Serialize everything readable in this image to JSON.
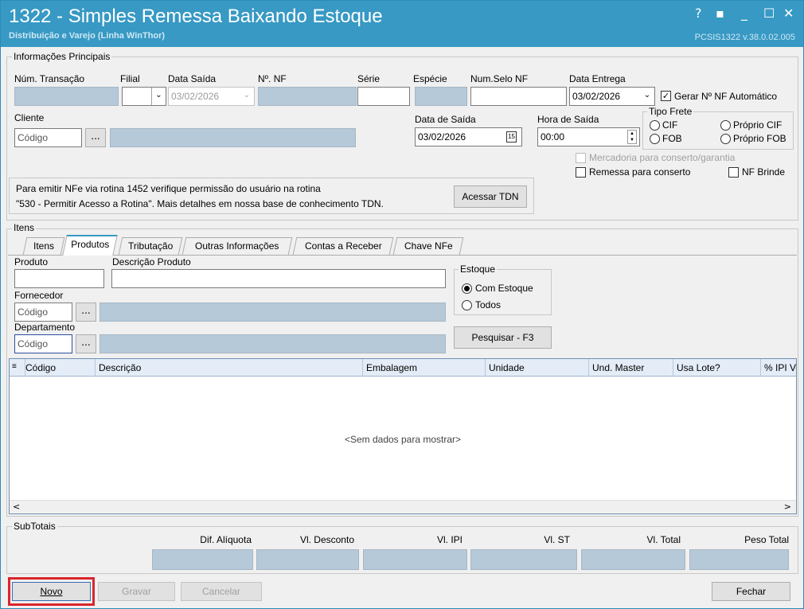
{
  "window": {
    "title": "1322 - Simples Remessa Baixando Estoque",
    "subtitle": "Distribuição e Varejo (Linha WinThor)",
    "version": "PCSIS1322  v.38.0.02.005",
    "controls": [
      "?",
      "▪",
      "_",
      "☐",
      "✕"
    ]
  },
  "principais": {
    "group_label": "Informações Principais",
    "labels": {
      "num_transacao": "Núm. Transação",
      "filial": "Filial",
      "data_saida": "Data Saída",
      "num_nf": "Nº. NF",
      "serie": "Série",
      "especie": "Espécie",
      "num_selo": "Num.Selo NF",
      "data_entrega": "Data Entrega",
      "cliente": "Cliente",
      "data_de_saida": "Data de Saída",
      "hora_saida": "Hora de Saída"
    },
    "values": {
      "data_saida": "03/02/2026",
      "data_entrega": "03/02/2026",
      "data_de_saida": "03/02/2026",
      "hora_saida": "00:00",
      "cliente_placeholder": "Código",
      "ellipsis": "..."
    },
    "gerar_nf": {
      "label": "Gerar Nº NF Automático",
      "checked": true
    },
    "tipo_frete": {
      "label": "Tipo Frete",
      "options": [
        "CIF",
        "Próprio CIF",
        "FOB",
        "Próprio FOB"
      ]
    },
    "mercadoria": "Mercadoria para conserto/garantia",
    "remessa": "Remessa para conserto",
    "nf_brinde": "NF Brinde",
    "info_line1": "Para emitir NFe via rotina 1452 verifique permissão do usuário na rotina",
    "info_line2": "\"530 - Permitir Acesso a Rotina\". Mais detalhes em nossa base de conhecimento TDN.",
    "acessar_tdn": "Acessar TDN"
  },
  "itens": {
    "group_label": "Itens",
    "tabs": [
      "Itens",
      "Produtos",
      "Tributação",
      "Outras Informações",
      "Contas a Receber",
      "Chave NFe"
    ],
    "active_tab": "Produtos",
    "produto_label": "Produto",
    "descricao_label": "Descrição Produto",
    "fornecedor_label": "Fornecedor",
    "departamento_label": "Departamento",
    "codigo_placeholder": "Código",
    "estoque": {
      "label": "Estoque",
      "options": [
        "Com Estoque",
        "Todos"
      ],
      "selected": "Com Estoque"
    },
    "pesquisar": "Pesquisar - F3"
  },
  "grid": {
    "columns": [
      "Código",
      "Descrição",
      "Embalagem",
      "Unidade",
      "Und. Master",
      "Usa Lote?",
      "% IPI Ve"
    ],
    "empty_text": "<Sem dados para mostrar>",
    "scroll_left": "<",
    "scroll_right": ">"
  },
  "subtotais": {
    "label": "SubTotais",
    "columns": [
      "Dif. Alíquota",
      "Vl. Desconto",
      "Vl. IPI",
      "Vl. ST",
      "Vl. Total",
      "Peso Total"
    ]
  },
  "footer": {
    "novo": "Novo",
    "gravar": "Gravar",
    "cancelar": "Cancelar",
    "fechar": "Fechar"
  }
}
